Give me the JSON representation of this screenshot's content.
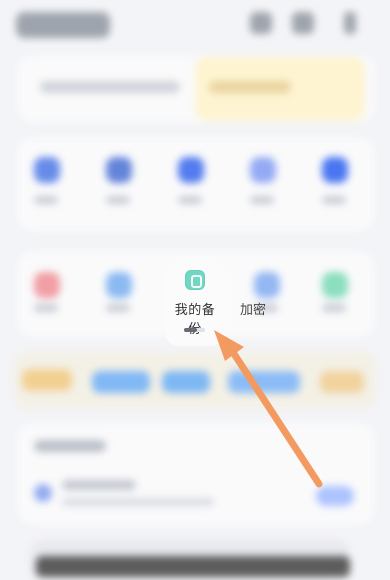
{
  "focus_item": {
    "label": "我的备份",
    "icon": "backup-icon"
  },
  "partial_item": {
    "label": "加密"
  },
  "pager": {
    "active_index": 0,
    "total": 2
  },
  "annotation": {
    "arrow_color": "#f39a61"
  }
}
